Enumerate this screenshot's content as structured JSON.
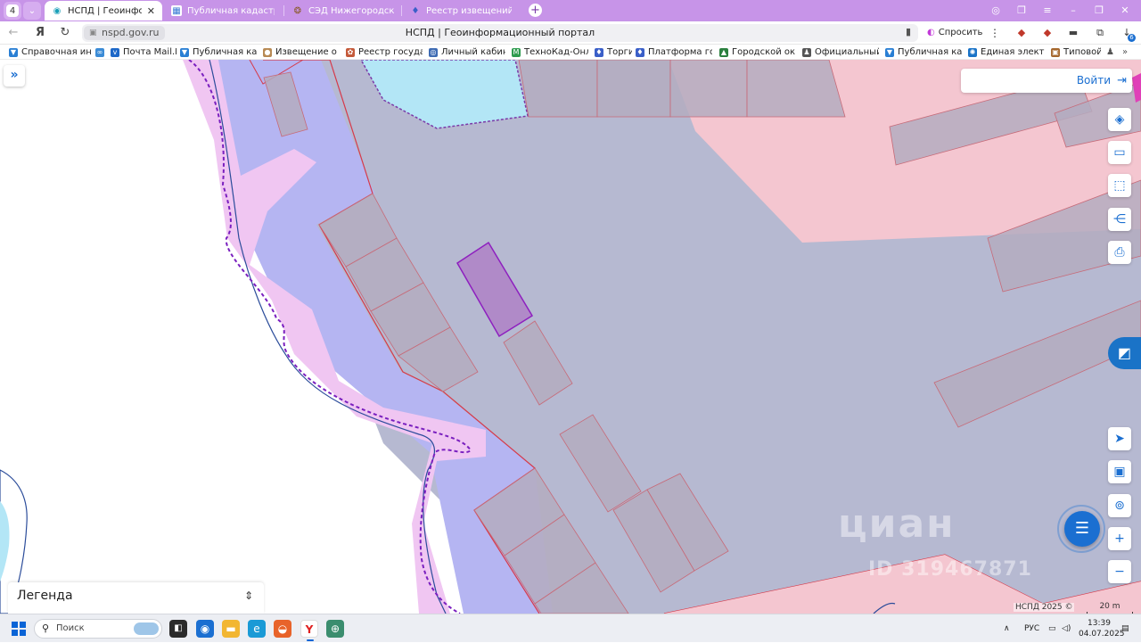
{
  "browser": {
    "tab_count": "4",
    "tabs": [
      {
        "label": "НСПД | Геоинформаци",
        "active": true
      },
      {
        "label": "Публичная кадастровая к"
      },
      {
        "label": "СЭД Нижегородская обл"
      },
      {
        "label": "Реестр извещений"
      }
    ],
    "url": "nspd.gov.ru",
    "page_title": "НСПД | Геоинформационный портал",
    "ask_label": "Спросить",
    "ext_badge": "6"
  },
  "bookmarks": [
    "Справочная инфо",
    "Почта Mail.Ru",
    "Публичная кадас",
    "Извещение о про",
    "Реестр государст",
    "Личный кабинет",
    "ТехноКад-Онлайн",
    "Торги",
    "Платформа госуд",
    "Городской округ",
    "Официальный по",
    "Публичная кадас",
    "Единая электрон",
    "Типовой"
  ],
  "map": {
    "login_label": "Войти",
    "legend_title": "Легенда",
    "attribution": "НСПД 2025 ©",
    "scale_label": "20 m",
    "watermark_brand": "циан",
    "watermark_id": "ID 319467871"
  },
  "taskbar": {
    "search_placeholder": "Поиск",
    "language": "РУС",
    "time": "13:39",
    "date": "04.07.2025"
  },
  "colors": {
    "tabbar": "#c794e8",
    "zone_gray": "#b6b9d1",
    "zone_blue": "#b5b5f2",
    "zone_pink": "#f0c6f2",
    "zone_red": "#f4c6d0",
    "water": "#b3e6f6",
    "parcel_line": "#d63a4a",
    "selected_parcel": "#b08ac8",
    "accent": "#1b6fd1"
  }
}
